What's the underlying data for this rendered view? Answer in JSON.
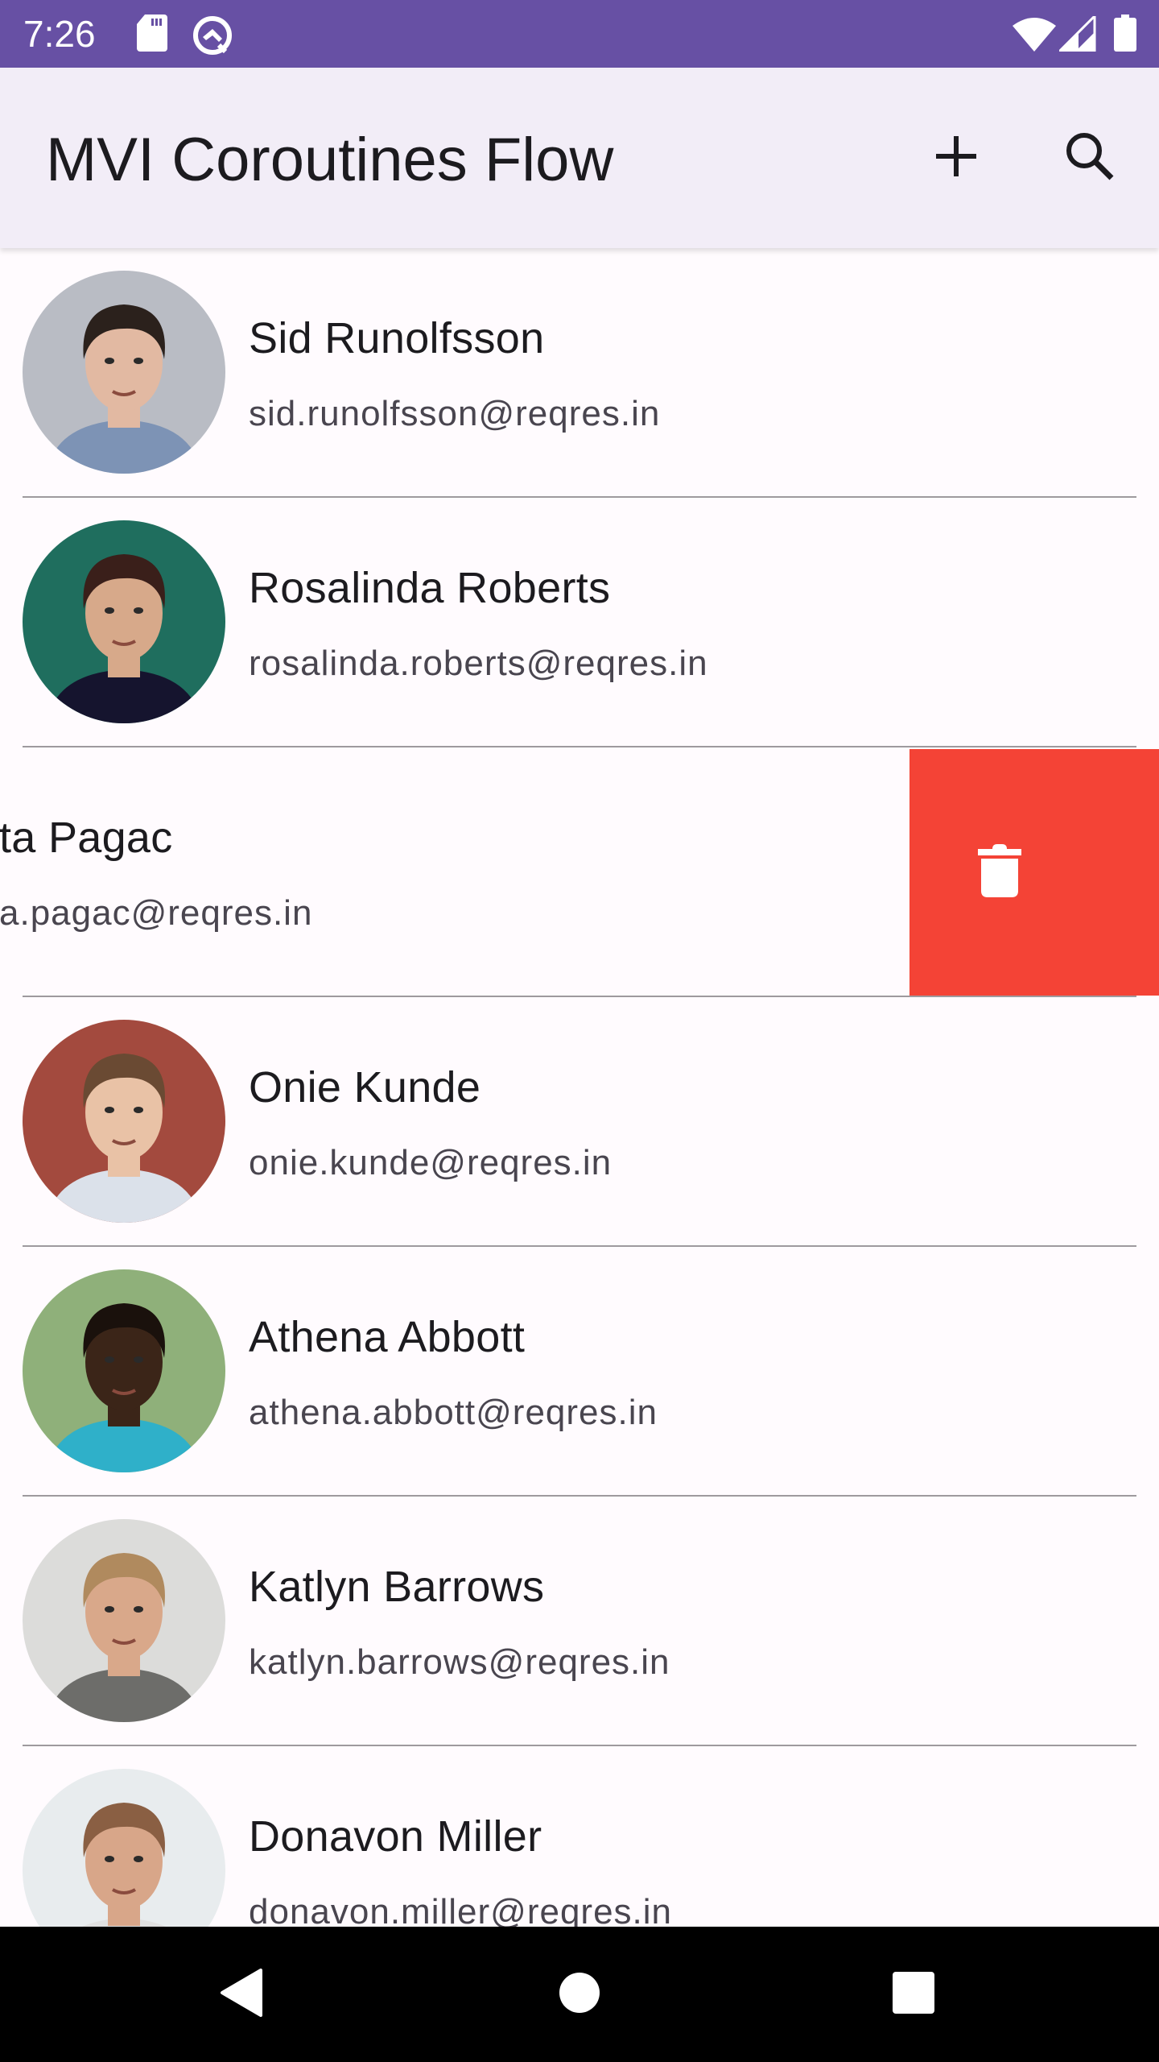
{
  "status_bar": {
    "time": "7:26",
    "left_icons": [
      "sd-card-icon",
      "app-notification-icon"
    ],
    "right_icons": [
      "wifi-icon",
      "cell-signal-icon",
      "battery-icon"
    ],
    "background_color": "#6750a4"
  },
  "toolbar": {
    "title": "MVI Coroutines Flow",
    "actions": [
      {
        "name": "add",
        "icon": "plus-icon"
      },
      {
        "name": "search",
        "icon": "search-icon"
      }
    ],
    "background_color": "#f2edf7"
  },
  "users": [
    {
      "name": "Sid Runolfsson",
      "email": "sid.runolfsson@reqres.in",
      "avatar": {
        "bg": "#b9bcc4",
        "skin": "#e2b9a2",
        "hair": "#2b211c",
        "shirt": "#7d93b5"
      }
    },
    {
      "name": "Rosalinda Roberts",
      "email": "rosalinda.roberts@reqres.in",
      "avatar": {
        "bg": "#1f6e5e",
        "skin": "#d7a98a",
        "hair": "#3a1f1a",
        "shirt": "#15142e"
      }
    },
    {
      "name": "Loyce Pagac",
      "visible_name": "ta Pagac",
      "visible_email": "a.pagac@reqres.in",
      "swiped": true
    },
    {
      "name": "Onie Kunde",
      "email": "onie.kunde@reqres.in",
      "avatar": {
        "bg": "#a34a3e",
        "skin": "#e9c2a6",
        "hair": "#6a4a33",
        "shirt": "#dbe1ea"
      }
    },
    {
      "name": "Athena Abbott",
      "email": "athena.abbott@reqres.in",
      "avatar": {
        "bg": "#8fb07a",
        "skin": "#3b2518",
        "hair": "#1a110c",
        "shirt": "#2fb0c9"
      }
    },
    {
      "name": "Katlyn Barrows",
      "email": "katlyn.barrows@reqres.in",
      "avatar": {
        "bg": "#dcdcda",
        "skin": "#d9a88a",
        "hair": "#b08a5e",
        "shirt": "#6d6d6a"
      }
    },
    {
      "name": "Donavon Miller",
      "email": "donavon.miller@reqres.in",
      "avatar": {
        "bg": "#e8ecee",
        "skin": "#d8a689",
        "hair": "#8a5f43",
        "shirt": "#e0e0e0"
      }
    }
  ],
  "swipe_action": {
    "icon": "trash-icon",
    "label": "delete",
    "color": "#f44336"
  },
  "nav_bar": {
    "buttons": [
      "back",
      "home",
      "recents"
    ]
  }
}
